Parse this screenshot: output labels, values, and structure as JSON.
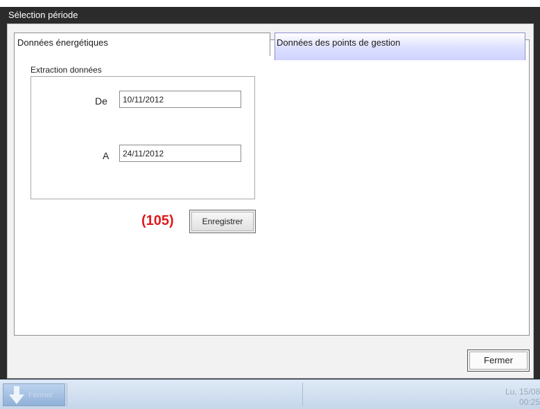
{
  "dialog": {
    "title": "Sélection période"
  },
  "tabs": [
    {
      "label": "Données énergétiques",
      "selected": false
    },
    {
      "label": "Données des points de gestion",
      "selected": true
    }
  ],
  "extraction": {
    "title": "Extraction données",
    "from_label": "De",
    "from_value": "10/11/2012",
    "to_label": "A",
    "to_value": "24/11/2012"
  },
  "annotation": "(105)",
  "buttons": {
    "save_label": "Enregistrer",
    "close_label": "Fermer"
  },
  "taskbar": {
    "button_label": "Fermer",
    "date_text": "Lu, 15/08",
    "time_text": "00:25"
  },
  "colors": {
    "annotation": "#e0191b",
    "selected_tab": "#cfd3ff",
    "title_bar": "#2b2b2b"
  }
}
